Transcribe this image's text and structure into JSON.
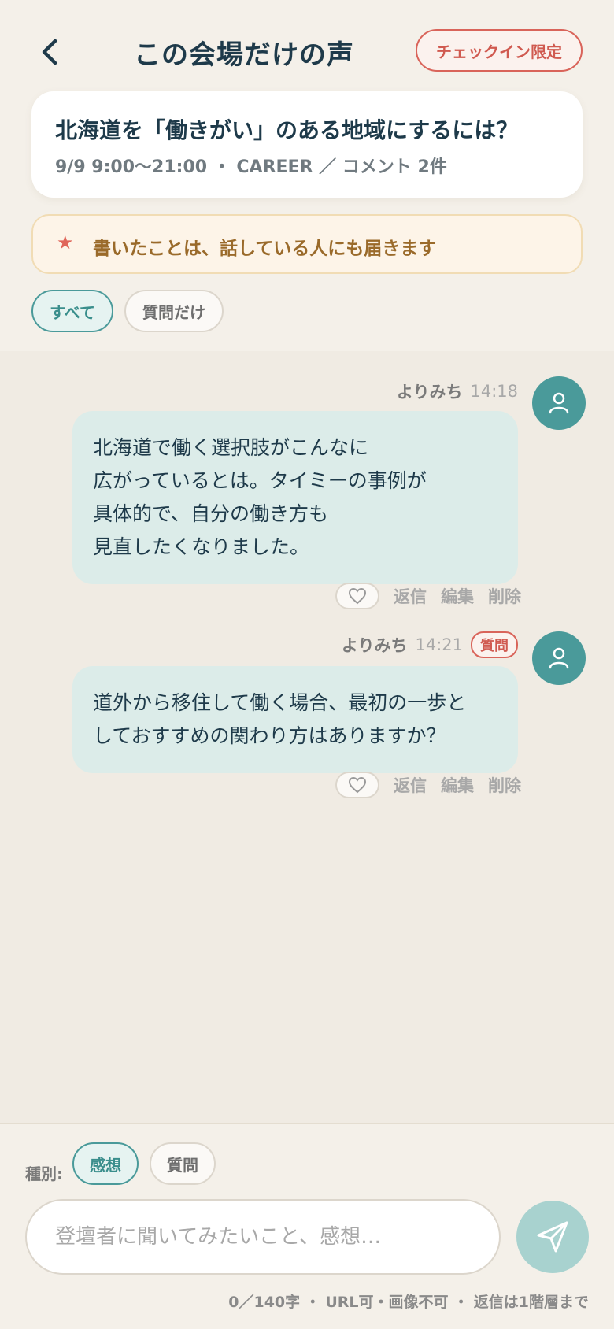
{
  "header": {
    "back_icon": "chevron-left-icon",
    "title": "この会場だけの声",
    "checkin_badge": "チェックイン限定"
  },
  "session": {
    "title": "北海道を「働きがい」のある地域にするには？",
    "meta": "9/9 9:00〜21:00 ・ CAREER ／ コメント 2件"
  },
  "notice": {
    "icon": "star-icon",
    "text": "書いたことは、話している人にも届きます"
  },
  "filters": {
    "all_label": "すべて",
    "questions_label": "質問だけ",
    "selected": "すべて"
  },
  "messages": [
    {
      "author": "よりみち",
      "time": "14:18",
      "badge": "",
      "lines": [
        "北海道で働く選択肢がこんなに",
        "広がっているとは。タイミーの事例が",
        "具体的で、自分の働き方も",
        "見直したくなりました。"
      ],
      "actions": {
        "reply": "返信",
        "edit": "編集",
        "delete": "削除"
      }
    },
    {
      "author": "よりみち",
      "time": "14:21",
      "badge": "質問",
      "lines": [
        "道外から移住して働く場合、最初の一歩と",
        "しておすすめの関わり方はありますか？"
      ],
      "actions": {
        "reply": "返信",
        "edit": "編集",
        "delete": "削除"
      }
    }
  ],
  "composer": {
    "type_label": "種別:",
    "type_impression": "感想",
    "type_question": "質問",
    "selected_type": "感想",
    "input_value": "",
    "placeholder": "登壇者に聞いてみたいこと、感想…",
    "send_icon": "paper-plane-icon",
    "footnote": "0／140字 ・ URL可・画像不可 ・ 返信は1階層まで"
  },
  "colors": {
    "accent": "#4a9a9a",
    "alert": "#d9645a",
    "bubble": "#dcece9",
    "background": "#f0ebe3"
  }
}
